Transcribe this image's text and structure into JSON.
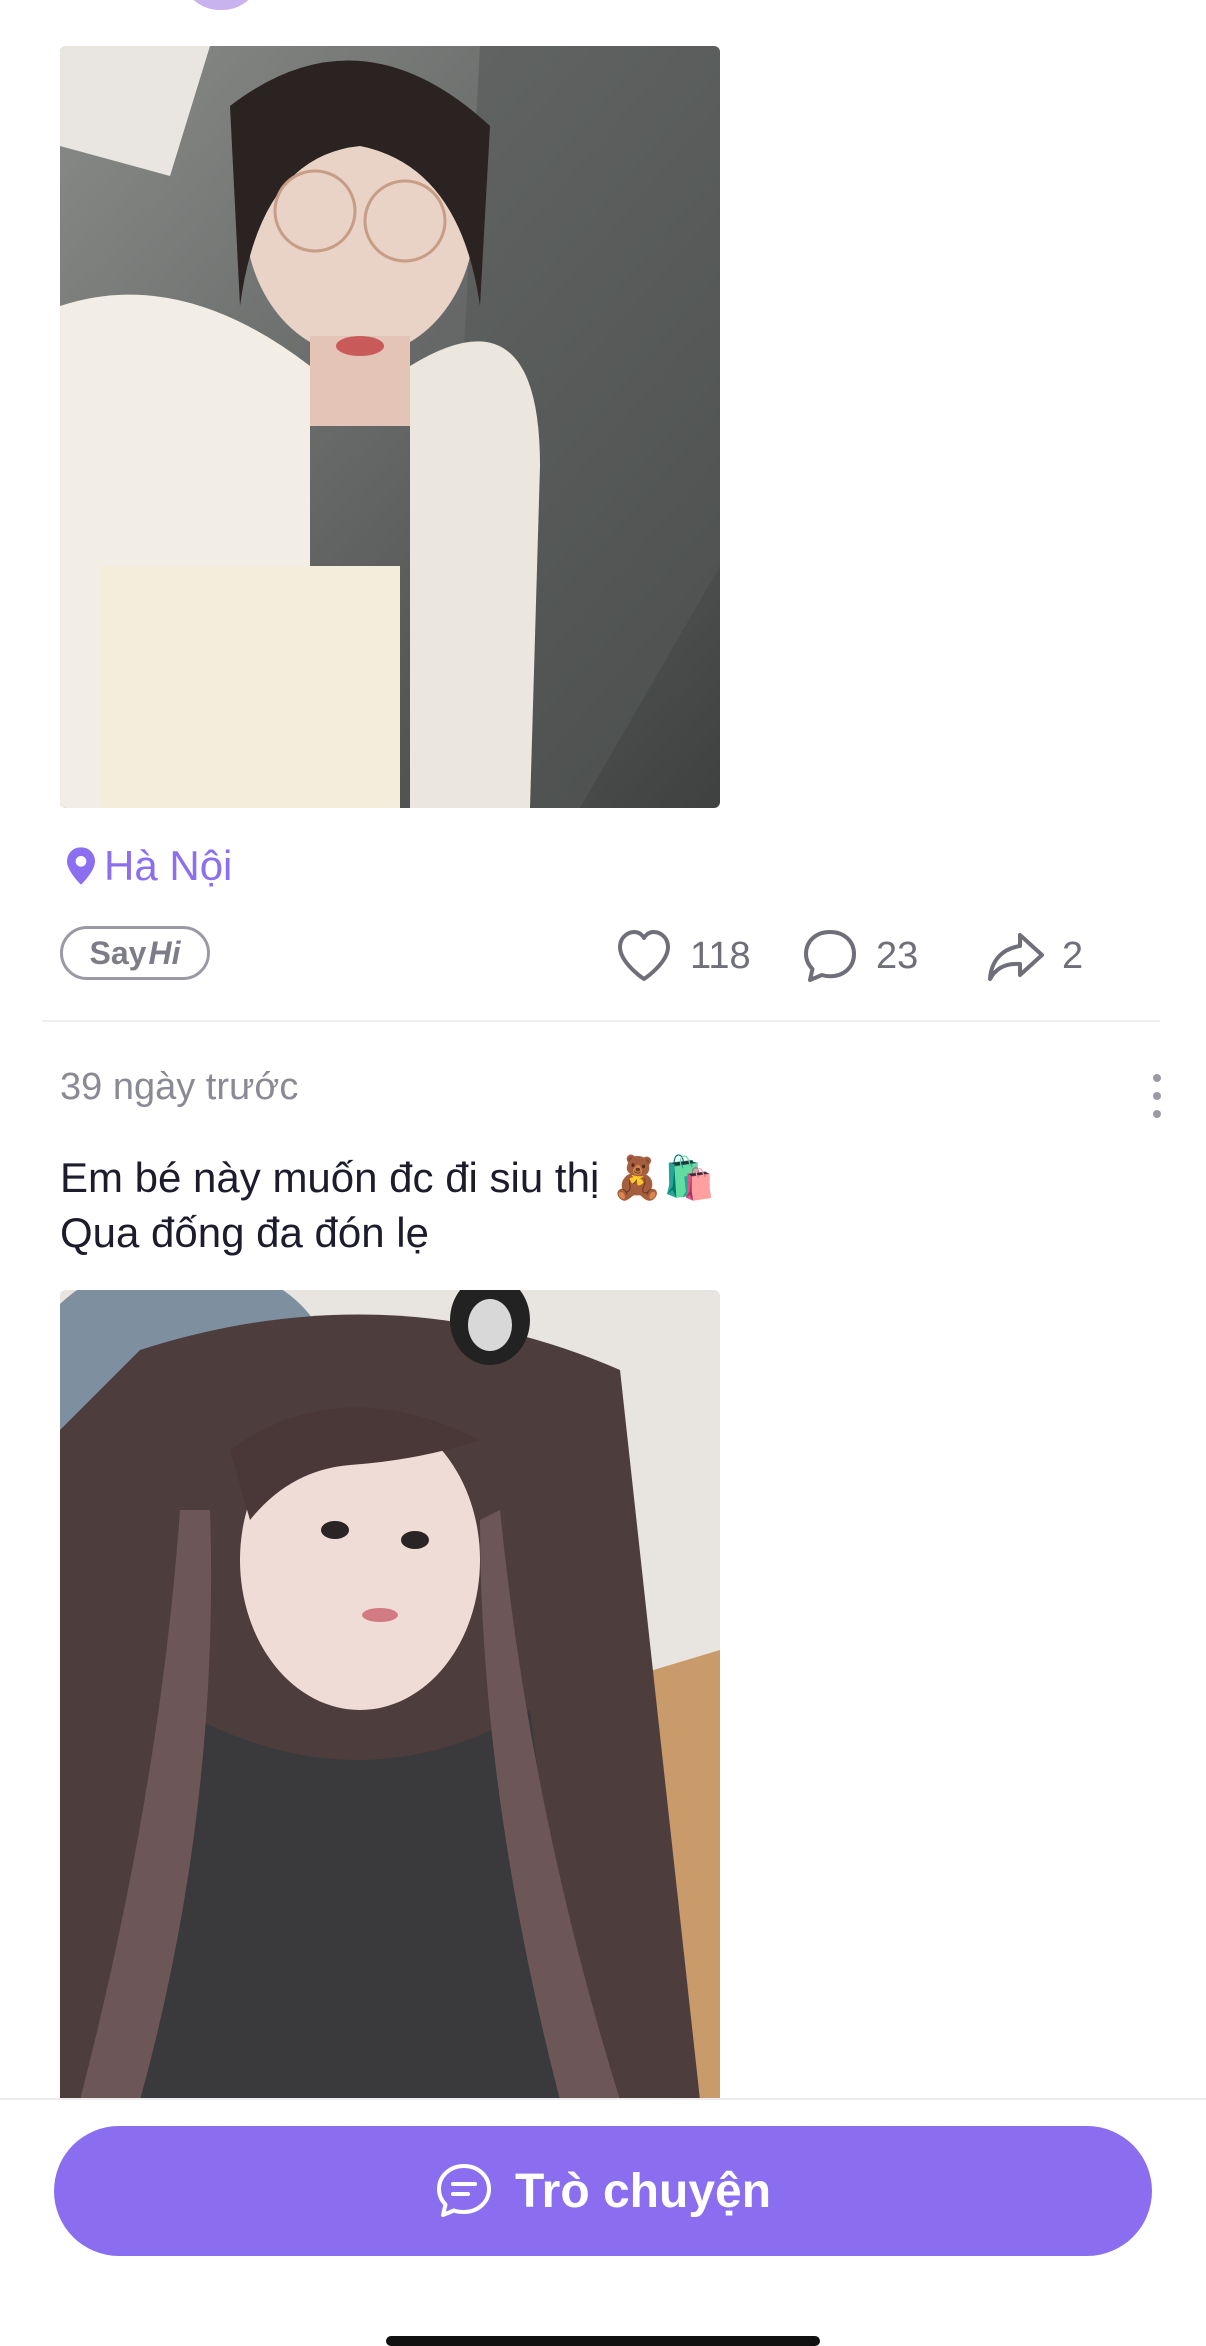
{
  "post1": {
    "location": "Hà Nội",
    "say_hi": {
      "say": "Say",
      "hi": "Hi"
    },
    "likes": "118",
    "comments": "23",
    "shares": "2"
  },
  "post2": {
    "time": "39 ngày trước",
    "caption_line1": "Em bé này muốn đc đi siu thị 🧸🛍️",
    "caption_line2": "Qua đống đa đón lẹ"
  },
  "chat_button": {
    "label": "Trò chuyện"
  },
  "colors": {
    "accent": "#8b6df0",
    "muted": "#6f6f7a"
  }
}
